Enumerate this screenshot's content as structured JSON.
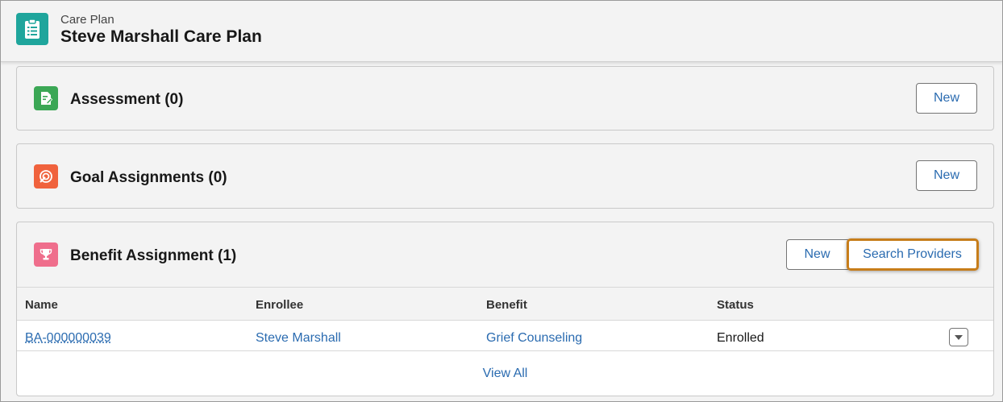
{
  "header": {
    "subtitle": "Care Plan",
    "title": "Steve Marshall Care Plan",
    "icon": "clipboard-list-icon",
    "icon_color": "#1fa59c"
  },
  "cards": {
    "assessment": {
      "title": "Assessment (0)",
      "icon": "assessment-doc-icon",
      "icon_color": "#3ba755",
      "new_label": "New"
    },
    "goals": {
      "title": "Goal Assignments (0)",
      "icon": "target-icon",
      "icon_color": "#f0623d",
      "new_label": "New"
    },
    "benefits": {
      "title": "Benefit Assignment (1)",
      "icon": "trophy-icon",
      "icon_color": "#ef6e8c",
      "new_label": "New",
      "search_label": "Search Providers",
      "highlight_color": "#c77d1a",
      "columns": [
        "Name",
        "Enrollee",
        "Benefit",
        "Status"
      ],
      "rows": [
        {
          "name": "BA-000000039",
          "enrollee": "Steve Marshall",
          "benefit": "Grief Counseling",
          "status": "Enrolled"
        }
      ],
      "view_all_label": "View All"
    }
  }
}
